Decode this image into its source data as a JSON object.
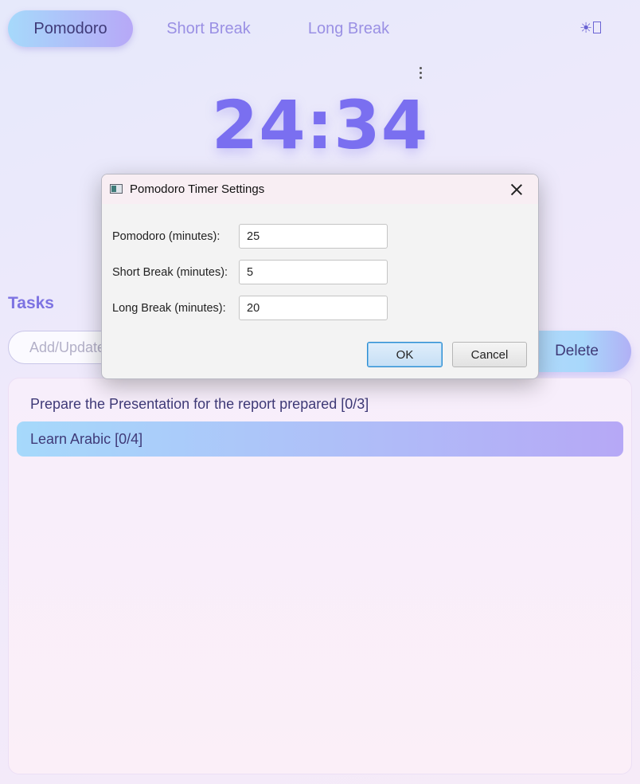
{
  "tabs": [
    {
      "label": "Pomodoro"
    },
    {
      "label": "Short Break"
    },
    {
      "label": "Long Break"
    }
  ],
  "theme_toggle": {
    "icon": "sun-icon",
    "glyph": "☀"
  },
  "menu_icon": "kebab-menu-icon",
  "timer": {
    "value": "24:34"
  },
  "tasks": {
    "heading": "Tasks",
    "input_placeholder": "Add/Update task",
    "delete_label": "Delete",
    "items": [
      {
        "label": "Prepare the Presentation for the report prepared [0/3]",
        "selected": false
      },
      {
        "label": "Learn Arabic [0/4]",
        "selected": true
      }
    ]
  },
  "dialog": {
    "title": "Pomodoro Timer Settings",
    "fields": [
      {
        "label": "Pomodoro (minutes):",
        "value": "25"
      },
      {
        "label": "Short Break (minutes):",
        "value": "5"
      },
      {
        "label": "Long Break (minutes):",
        "value": "20"
      }
    ],
    "ok_label": "OK",
    "cancel_label": "Cancel"
  },
  "colors": {
    "accent": "#7a6ff0",
    "tab_gradient_start": "#a6d9fb",
    "tab_gradient_end": "#b7a8f7"
  }
}
